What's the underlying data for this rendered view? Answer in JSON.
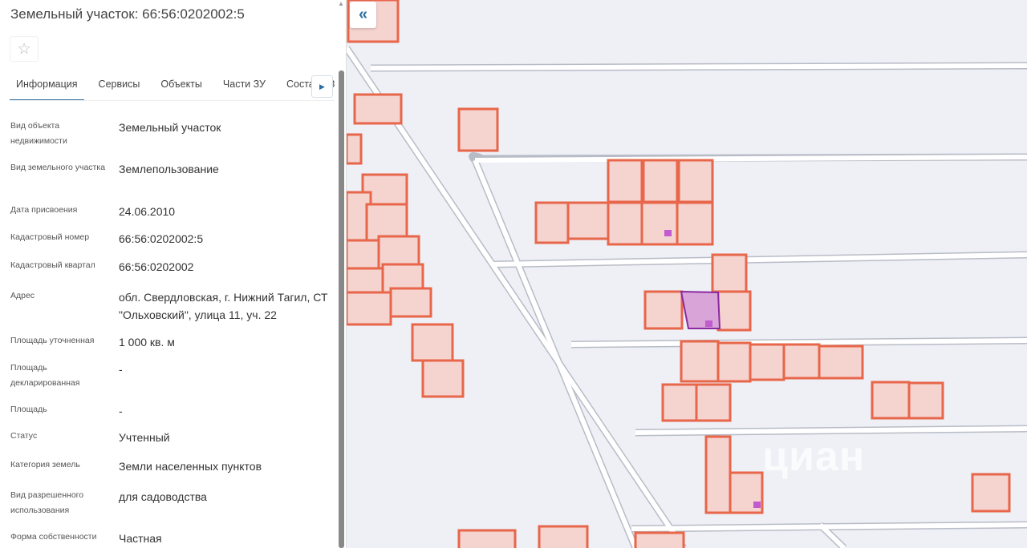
{
  "header": {
    "title": "Земельный участок: 66:56:0202002:5",
    "star_icon": "☆"
  },
  "tabs": [
    {
      "label": "Информация",
      "active": true
    },
    {
      "label": "Сервисы"
    },
    {
      "label": "Объекты"
    },
    {
      "label": "Части ЗУ"
    },
    {
      "label": "Состав ЕЗП"
    }
  ],
  "fields": [
    {
      "label": "Вид объекта недвижимости",
      "value": "Земельный участок"
    },
    {
      "label": "Вид земельного участка",
      "value": "Землепользование"
    },
    {
      "label": "Дата присвоения",
      "value": "24.06.2010"
    },
    {
      "label": "Кадастровый номер",
      "value": "66:56:0202002:5"
    },
    {
      "label": "Кадастровый квартал",
      "value": "66:56:0202002"
    },
    {
      "label": "Адрес",
      "value": "обл. Свердловская, г. Нижний Тагил, СТ \"Ольховский\", улица 11, уч. 22"
    },
    {
      "label": "Площадь уточненная",
      "value": "1 000 кв. м"
    },
    {
      "label": "Площадь декларированная",
      "value": "-"
    },
    {
      "label": "Площадь",
      "value": "-"
    },
    {
      "label": "Статус",
      "value": "Учтенный"
    },
    {
      "label": "Категория земель",
      "value": "Земли населенных пунктов"
    },
    {
      "label": "Вид разрешенного использования",
      "value": "для садоводства"
    },
    {
      "label": "Форма собственности",
      "value": "Частная"
    }
  ],
  "map": {
    "collapse_icon": "«",
    "watermark": "циан",
    "parcel_color": "#e8664a",
    "selected_color": "#9b30b0"
  }
}
